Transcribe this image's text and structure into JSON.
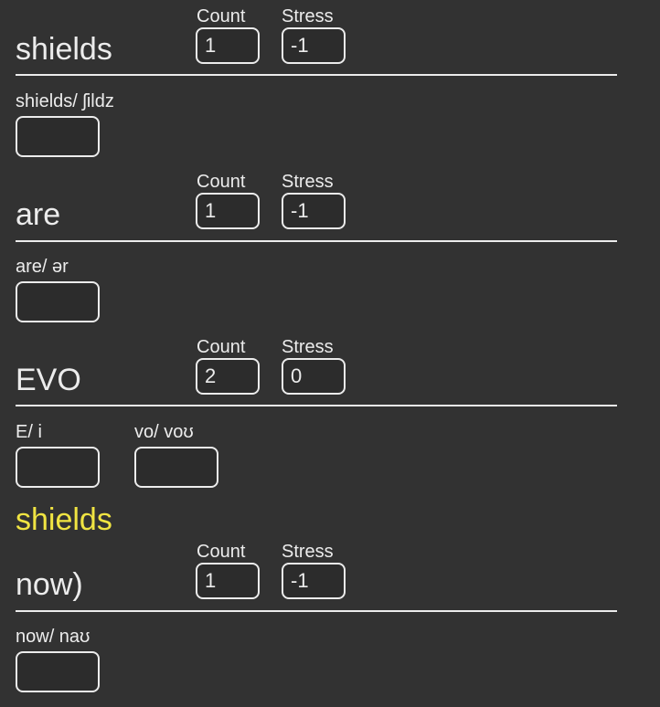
{
  "labels": {
    "count": "Count",
    "stress": "Stress"
  },
  "colors": {
    "background": "#323232",
    "text": "#ececec",
    "highlight": "#f0e442"
  },
  "words": [
    {
      "text": "shields",
      "count": "1",
      "stress": "-1",
      "syllables": [
        {
          "label": "shields/ ʃildz",
          "value": ""
        }
      ]
    },
    {
      "text": "are",
      "count": "1",
      "stress": "-1",
      "syllables": [
        {
          "label": "are/ ər",
          "value": ""
        }
      ]
    },
    {
      "text": "EVO",
      "count": "2",
      "stress": "0",
      "syllables": [
        {
          "label": "E/ i",
          "value": ""
        },
        {
          "label": "vo/ voʊ",
          "value": ""
        }
      ]
    },
    {
      "text": "now)",
      "count": "1",
      "stress": "-1",
      "syllables": [
        {
          "label": "now/ naʊ",
          "value": ""
        }
      ]
    }
  ],
  "highlighted_word": "shields"
}
